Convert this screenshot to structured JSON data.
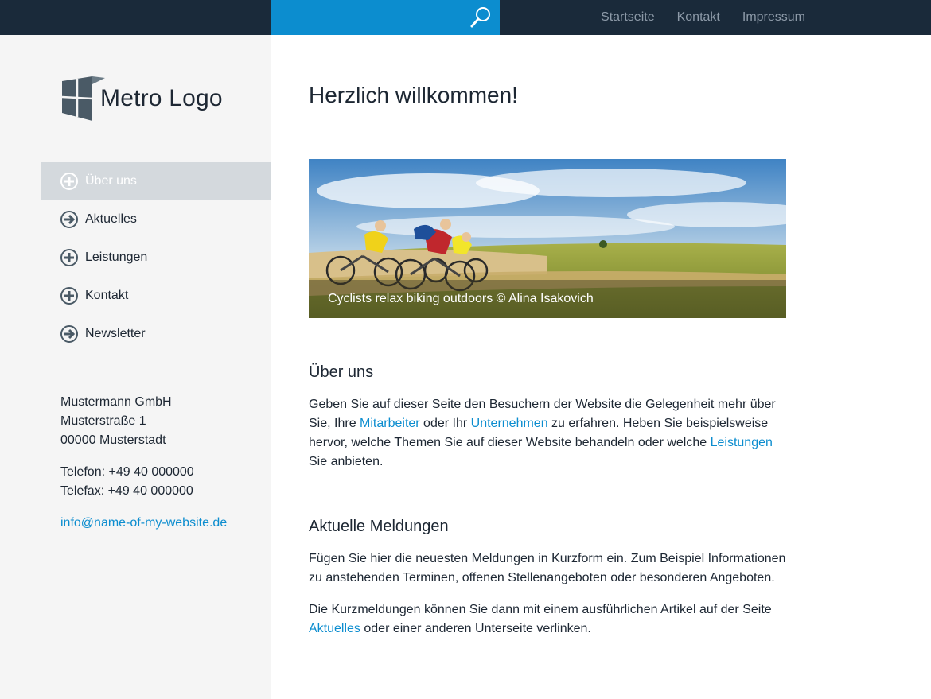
{
  "header": {
    "nav": [
      {
        "label": "Startseite"
      },
      {
        "label": "Kontakt"
      },
      {
        "label": "Impressum"
      }
    ]
  },
  "logo": {
    "text": "Metro Logo"
  },
  "sidebar": {
    "items": [
      {
        "label": "Über uns",
        "icon": "plus-circle-icon",
        "active": true
      },
      {
        "label": "Aktuelles",
        "icon": "arrow-right-circle-icon"
      },
      {
        "label": "Leistungen",
        "icon": "plus-circle-icon"
      },
      {
        "label": "Kontakt",
        "icon": "plus-circle-icon"
      },
      {
        "label": "Newsletter",
        "icon": "arrow-right-circle-icon"
      }
    ],
    "address": {
      "company": "Mustermann GmbH",
      "street": "Musterstraße 1",
      "city": "00000 Musterstadt",
      "phone": "Telefon: +49 40 000000",
      "fax": "Telefax: +49 40 000000",
      "email": "info@name-of-my-website.de"
    }
  },
  "main": {
    "title": "Herzlich willkommen!",
    "hero_caption": "Cyclists relax biking outdoors © Alina Isakovich",
    "about": {
      "heading": "Über uns",
      "t1": "Geben Sie auf dieser Seite den Besuchern der Website die Gelegenheit mehr über Sie, Ihre ",
      "link1": "Mitarbeiter",
      "t2": " oder Ihr ",
      "link2": "Unternehmen",
      "t3": " zu erfahren. Heben Sie beispielsweise hervor, welche Themen Sie auf dieser Website behandeln oder welche ",
      "link3": "Leistungen",
      "t4": " Sie anbieten."
    },
    "news": {
      "heading": "Aktuelle Meldungen",
      "p1": "Fügen Sie hier die neuesten Meldungen in Kurzform ein. Zum Beispiel Informationen zu anstehenden Terminen, offenen Stellenangeboten oder besonderen Angeboten.",
      "p2_text": "Die Kurzmeldungen können Sie dann mit einem ausführlichen Artikel auf der Seite ",
      "p2_link": "Aktuelles",
      "p2_end": " oder einer anderen Unterseite verlinken."
    }
  },
  "colors": {
    "topbar": "#1a2a3a",
    "search": "#0c8dcf",
    "link": "#0c8dcf",
    "sidebar": "#f5f5f5",
    "active": "#d4d9dd"
  }
}
